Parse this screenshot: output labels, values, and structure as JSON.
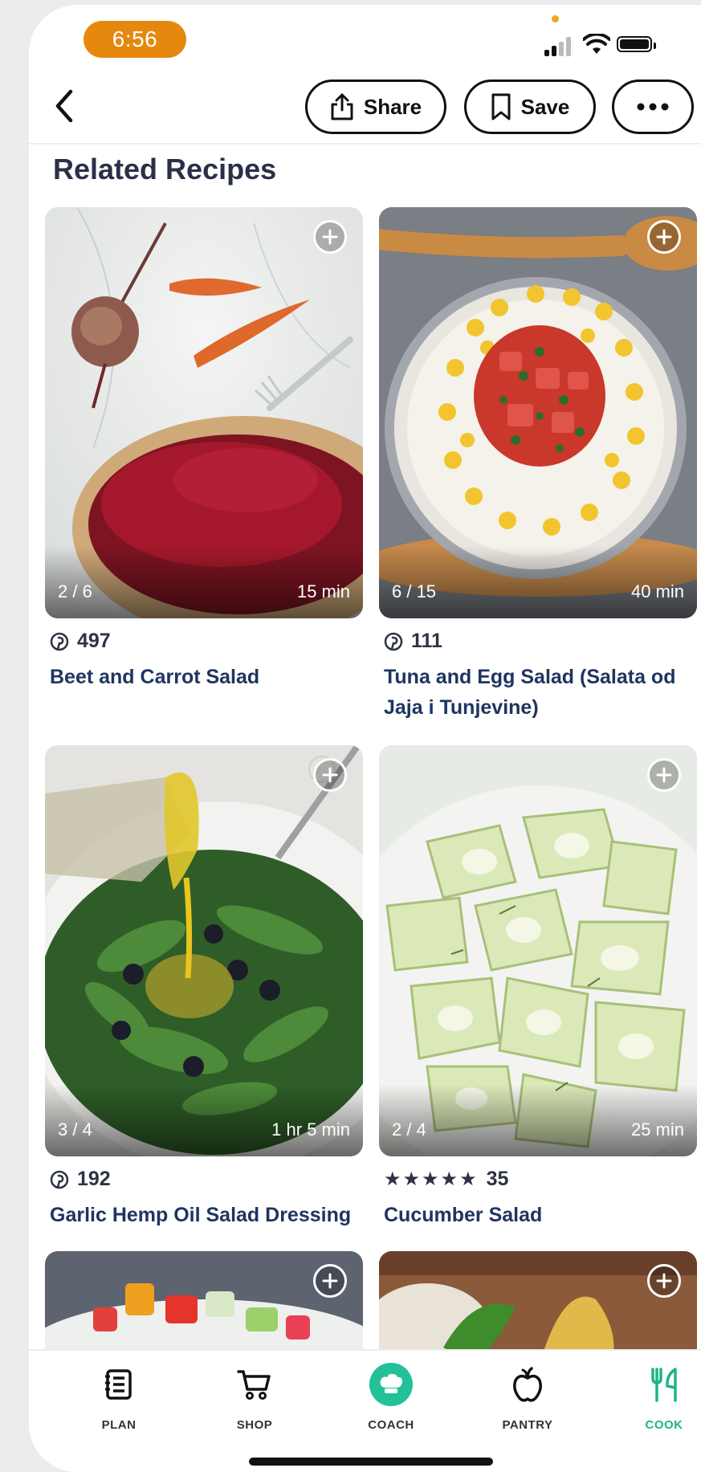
{
  "status_bar": {
    "time": "6:56"
  },
  "nav": {
    "back_label": "",
    "share_label": "Share",
    "save_label": "Save"
  },
  "section_title": "Related Recipes",
  "recipes": [
    {
      "image_count": "2 / 6",
      "time": "15 min",
      "meta_type": "pinterest",
      "meta_value": "497",
      "title": "Beet and Carrot Salad"
    },
    {
      "image_count": "6 / 15",
      "time": "40 min",
      "meta_type": "pinterest",
      "meta_value": "111",
      "title": "Tuna and Egg Salad (Salata od Jaja i Tunjevine)"
    },
    {
      "image_count": "3 / 4",
      "time": "1 hr 5 min",
      "meta_type": "pinterest",
      "meta_value": "192",
      "title": "Garlic Hemp Oil Salad Dressing"
    },
    {
      "image_count": "2 / 4",
      "time": "25 min",
      "meta_type": "stars",
      "stars": "★★★★★",
      "meta_value": "35",
      "title": "Cucumber Salad"
    }
  ],
  "tabs": [
    {
      "label": "PLAN",
      "icon": "list-icon"
    },
    {
      "label": "SHOP",
      "icon": "cart-icon"
    },
    {
      "label": "COACH",
      "icon": "chef-hat-icon"
    },
    {
      "label": "PANTRY",
      "icon": "apple-icon"
    },
    {
      "label": "COOK",
      "icon": "fork-knife-icon",
      "active": true
    }
  ],
  "colors": {
    "accent": "#22c198",
    "time_pill": "#e6880e",
    "title_blue": "#1f3560"
  }
}
